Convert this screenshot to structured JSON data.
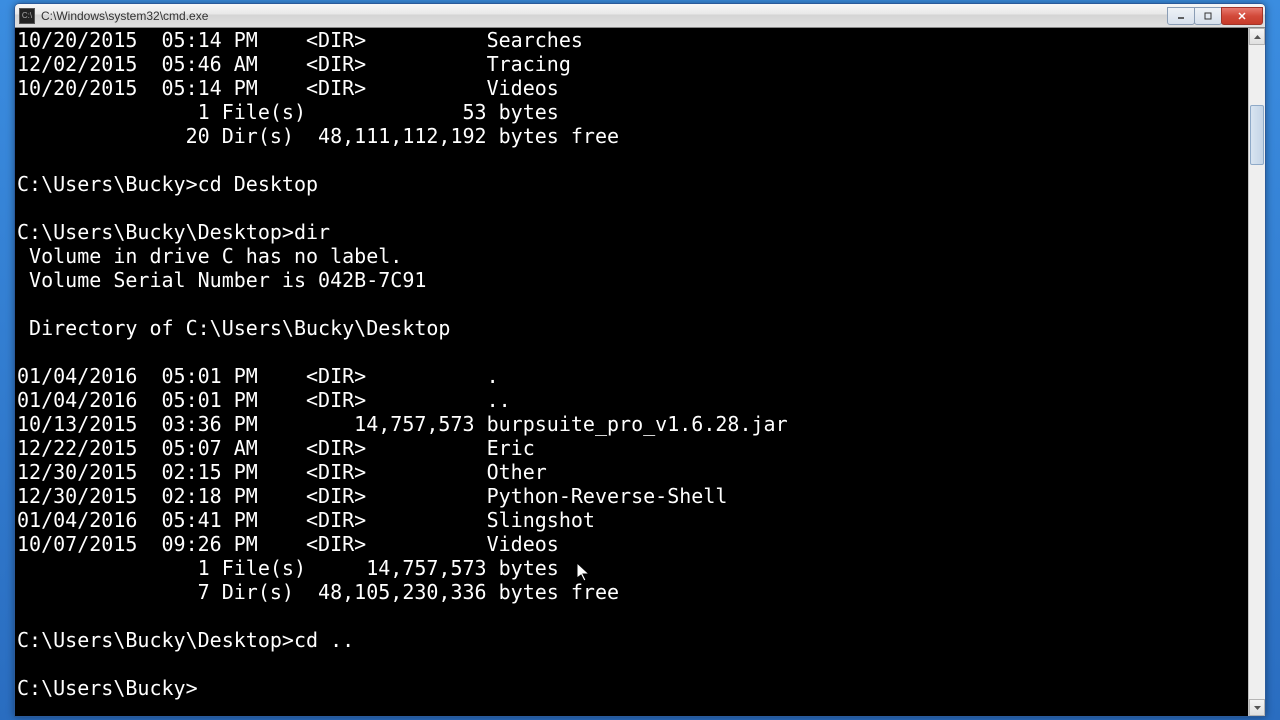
{
  "window": {
    "title": "C:\\Windows\\system32\\cmd.exe"
  },
  "lines": [
    "10/20/2015  05:14 PM    <DIR>          Searches",
    "12/02/2015  05:46 AM    <DIR>          Tracing",
    "10/20/2015  05:14 PM    <DIR>          Videos",
    "               1 File(s)             53 bytes",
    "              20 Dir(s)  48,111,112,192 bytes free",
    "",
    "C:\\Users\\Bucky>cd Desktop",
    "",
    "C:\\Users\\Bucky\\Desktop>dir",
    " Volume in drive C has no label.",
    " Volume Serial Number is 042B-7C91",
    "",
    " Directory of C:\\Users\\Bucky\\Desktop",
    "",
    "01/04/2016  05:01 PM    <DIR>          .",
    "01/04/2016  05:01 PM    <DIR>          ..",
    "10/13/2015  03:36 PM        14,757,573 burpsuite_pro_v1.6.28.jar",
    "12/22/2015  05:07 AM    <DIR>          Eric",
    "12/30/2015  02:15 PM    <DIR>          Other",
    "12/30/2015  02:18 PM    <DIR>          Python-Reverse-Shell",
    "01/04/2016  05:41 PM    <DIR>          Slingshot",
    "10/07/2015  09:26 PM    <DIR>          Videos",
    "               1 File(s)     14,757,573 bytes",
    "               7 Dir(s)  48,105,230,336 bytes free",
    "",
    "C:\\Users\\Bucky\\Desktop>cd ..",
    "",
    "C:\\Users\\Bucky>"
  ]
}
